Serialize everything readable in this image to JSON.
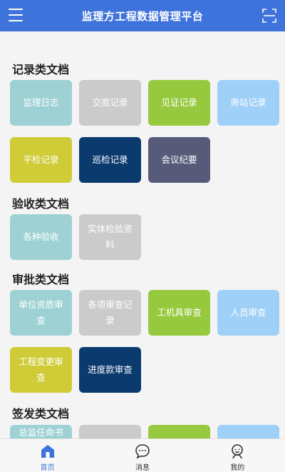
{
  "header": {
    "title": "监理方工程数据管理平台"
  },
  "sections": [
    {
      "title": "记录类文档",
      "tiles": [
        "监理日志",
        "交底记录",
        "见证记录",
        "旁站记录",
        "平检记录",
        "巡检记录",
        "会议纪要"
      ]
    },
    {
      "title": "验收类文档",
      "tiles": [
        "各种验收",
        "实体检验资料"
      ]
    },
    {
      "title": "审批类文档",
      "tiles": [
        "单位资质审查",
        "各项审查记录",
        "工机具审查",
        "人员审查",
        "工程变更审查",
        "进度款审查"
      ]
    },
    {
      "title": "签发类文档",
      "tiles": [
        "总监任命书",
        "",
        "",
        ""
      ]
    }
  ],
  "bottom_nav": {
    "home": "首页",
    "messages": "消息",
    "mine": "我的"
  },
  "colors": {
    "header": "#3f73dc",
    "teal": "#9dd1d4",
    "gray": "#cbcbcb",
    "green": "#97c93e",
    "light_blue": "#9fd0f8",
    "yellow": "#cfcc38",
    "navy": "#0a3a6e",
    "slate": "#575b79"
  }
}
